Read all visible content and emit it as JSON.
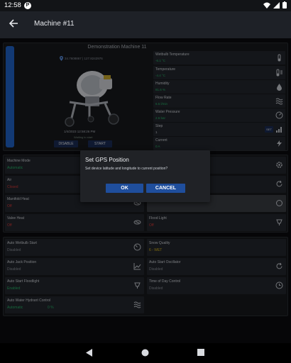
{
  "status_bar": {
    "time": "12:58",
    "app_badge": "P",
    "icons": [
      "wifi-icon",
      "signal-icon",
      "battery-icon"
    ]
  },
  "app_bar": {
    "title": "Machine #11",
    "back_icon": "arrow-left-icon"
  },
  "overview": {
    "title": "Demonstration Machine 11",
    "coords": "34.7608867 | 127.8242976",
    "timestamp": "1/4/2023 12:58:26 PM",
    "waiting": "Waiting to start",
    "disable_label": "DISABLE",
    "start_label": "START"
  },
  "sensors": [
    {
      "label": "Wetbulb Temperature",
      "value": "-6.1 °C",
      "icon": "thermometer-icon"
    },
    {
      "label": "Temperature",
      "value": "-4.4 °C",
      "icon": "thermometer-wind-icon"
    },
    {
      "label": "Humidity",
      "value": "81.6 %",
      "icon": "water-drop-icon"
    },
    {
      "label": "Flow Rate",
      "value": "6.5 l/min",
      "icon": "waves-icon"
    },
    {
      "label": "Water Pressure",
      "value": "2.6 bar",
      "icon": "gauge-icon"
    },
    {
      "label": "Step",
      "value": "1",
      "set_label": "SET",
      "icon": "bars-icon"
    },
    {
      "label": "Current",
      "value": "0 A",
      "icon": "lightning-icon"
    }
  ],
  "controls_group1": {
    "machine_mode": {
      "label": "Machine Mode",
      "value": "Automatic",
      "icon": "settings-icon"
    },
    "air": {
      "label": "Air",
      "value": "Closed",
      "icon": "refresh-icon"
    },
    "manifold_heat": {
      "label": "Manifold Heat",
      "value": "Off",
      "icon": "heat-icon"
    },
    "valve_heat": {
      "label": "Valve Heat",
      "value": "Off",
      "icon": "heat-icon"
    },
    "flood_light": {
      "label": "Flood Light",
      "value": "Off",
      "icon": "floodlight-icon"
    }
  },
  "controls_group2": {
    "auto_wetbulb": {
      "label": "Auto Wetbulb Start",
      "value": "Disabled",
      "icon": "speed-icon"
    },
    "auto_jack": {
      "label": "Auto Jack Position",
      "value": "Disabled",
      "icon": "chart-icon"
    },
    "auto_floodlight": {
      "label": "Auto Start Floodlight",
      "value": "Enabled",
      "icon": "floodlight-icon"
    },
    "auto_hydrant": {
      "label": "Auto Water Hydrant Control",
      "value": "Automatic",
      "value2": "0 %",
      "icon": "waves-icon"
    },
    "snow_quality": {
      "label": "Snow Quality",
      "value": "6 - WET"
    },
    "auto_oscillator": {
      "label": "Auto Start Oscillator",
      "value": "Disabled",
      "icon": "refresh-icon"
    },
    "time_of_day": {
      "label": "Time of Day Control",
      "value": "Disabled",
      "icon": "clock-icon"
    }
  },
  "dialog": {
    "title": "Set GPS Position",
    "message": "Set device latitude and longitude to current position?",
    "ok_label": "OK",
    "cancel_label": "CANCEL"
  },
  "nav_bar": {
    "back": "back-triangle-icon",
    "home": "home-circle-icon",
    "recents": "recents-square-icon"
  },
  "colors": {
    "accent": "#1f63c8",
    "button": "#1f4e9c",
    "ok_green": "#27b469",
    "off_red": "#d63838",
    "warn_amber": "#d8b51a"
  }
}
